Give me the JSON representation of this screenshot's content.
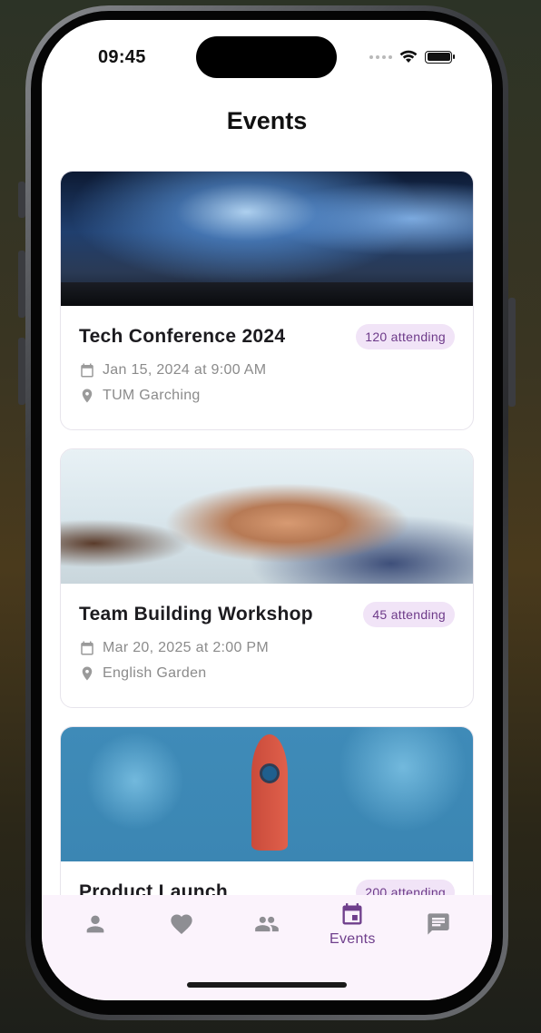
{
  "status_bar": {
    "time": "09:45"
  },
  "header": {
    "title": "Events"
  },
  "events": [
    {
      "title": "Tech Conference 2024",
      "attending": "120 attending",
      "date": "Jan 15, 2024 at 9:00 AM",
      "location": "TUM Garching"
    },
    {
      "title": "Team Building Workshop",
      "attending": "45 attending",
      "date": "Mar 20, 2025 at 2:00 PM",
      "location": "English Garden"
    },
    {
      "title": "Product Launch",
      "attending": "200 attending"
    }
  ],
  "bottom_nav": {
    "items": [
      {
        "icon": "person-icon",
        "label": ""
      },
      {
        "icon": "heart-icon",
        "label": ""
      },
      {
        "icon": "people-icon",
        "label": ""
      },
      {
        "icon": "calendar-icon",
        "label": "Events"
      },
      {
        "icon": "chat-icon",
        "label": ""
      }
    ],
    "active_index": 3,
    "active_color": "#6f3f8c",
    "inactive_color": "#8e8e93"
  },
  "colors": {
    "badge_bg": "#f1e4f7",
    "badge_text": "#6d3a89",
    "nav_bg": "#fbf3fc"
  }
}
